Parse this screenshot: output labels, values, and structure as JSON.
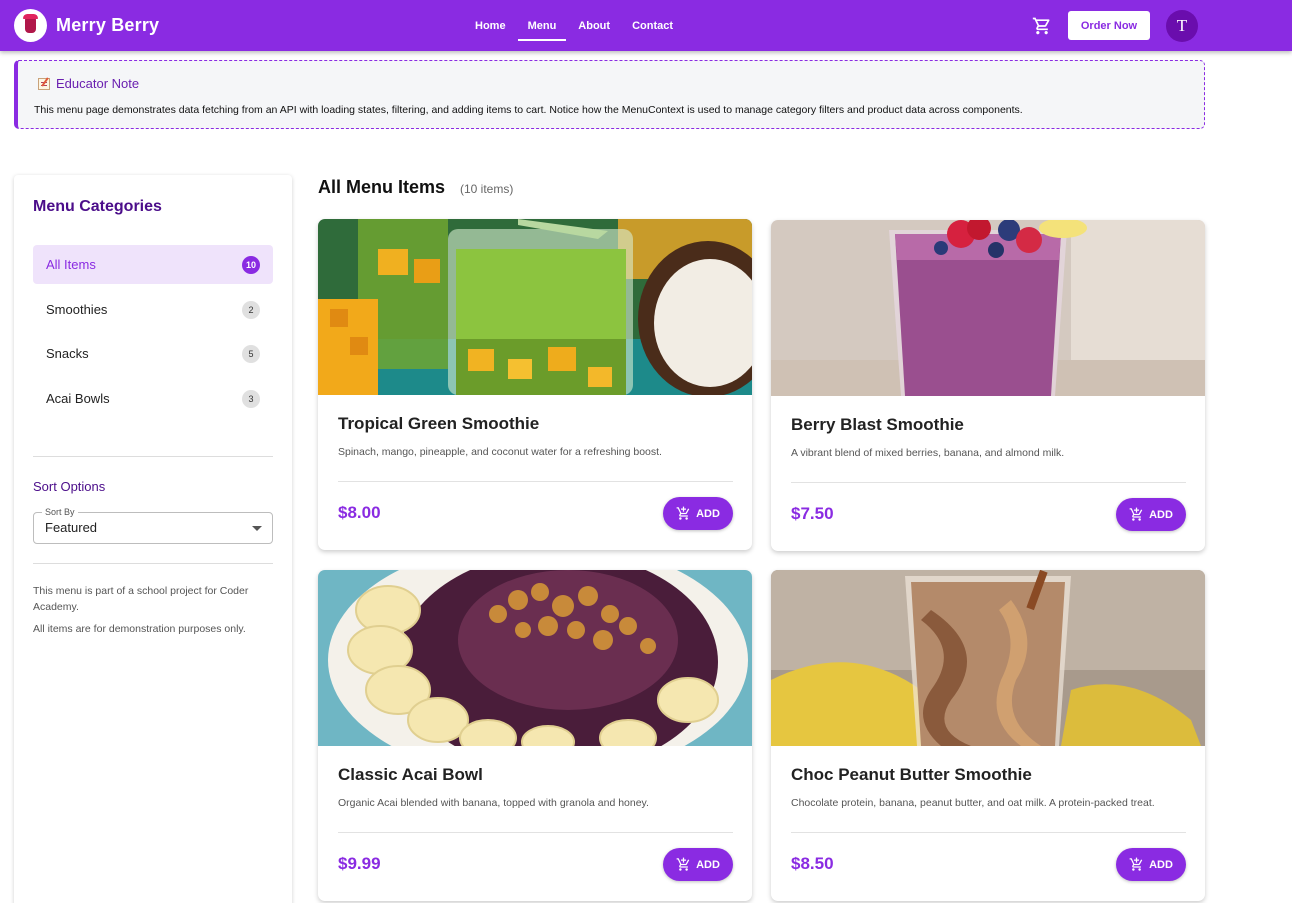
{
  "header": {
    "brand_name": "Merry Berry",
    "nav": [
      "Home",
      "Menu",
      "About",
      "Contact"
    ],
    "active_nav": "Menu",
    "order_button": "Order Now",
    "avatar_letter": "T",
    "icons": [
      "brand-logo",
      "cart-icon"
    ]
  },
  "educator_note": {
    "title": "Educator Note",
    "text": "This menu page demonstrates data fetching from an API with loading states, filtering, and adding items to cart. Notice how the MenuContext is used to manage category filters and product data across components."
  },
  "sidebar": {
    "title": "Menu Categories",
    "categories": [
      {
        "label": "All Items",
        "count": "10",
        "active": true
      },
      {
        "label": "Smoothies",
        "count": "2",
        "active": false
      },
      {
        "label": "Snacks",
        "count": "5",
        "active": false
      },
      {
        "label": "Acai Bowls",
        "count": "3",
        "active": false
      }
    ],
    "sort_title": "Sort Options",
    "sort_label": "Sort By",
    "sort_value": "Featured",
    "info_1": "This menu is part of a school project for Coder Academy.",
    "info_2": "All items are for demonstration purposes only."
  },
  "main": {
    "title": "All Menu Items",
    "count_text": "(10 items)",
    "add_label": "ADD",
    "items": [
      {
        "name": "Tropical Green Smoothie",
        "description": "Spinach, mango, pineapple, and coconut water for a refreshing boost.",
        "price": "$8.00"
      },
      {
        "name": "Berry Blast Smoothie",
        "description": "A vibrant blend of mixed berries, banana, and almond milk.",
        "price": "$7.50"
      },
      {
        "name": "Classic Acai Bowl",
        "description": "Organic Acai blended with banana, topped with granola and honey.",
        "price": "$9.99"
      },
      {
        "name": "Choc Peanut Butter Smoothie",
        "description": "Chocolate protein, banana, peanut butter, and oat milk. A protein-packed treat.",
        "price": "$8.50"
      }
    ]
  },
  "colors": {
    "primary": "#8a2be2",
    "primary_dark": "#4b0d8a",
    "active_bg": "#efe3fb",
    "note_bg": "#f5f6f8"
  }
}
